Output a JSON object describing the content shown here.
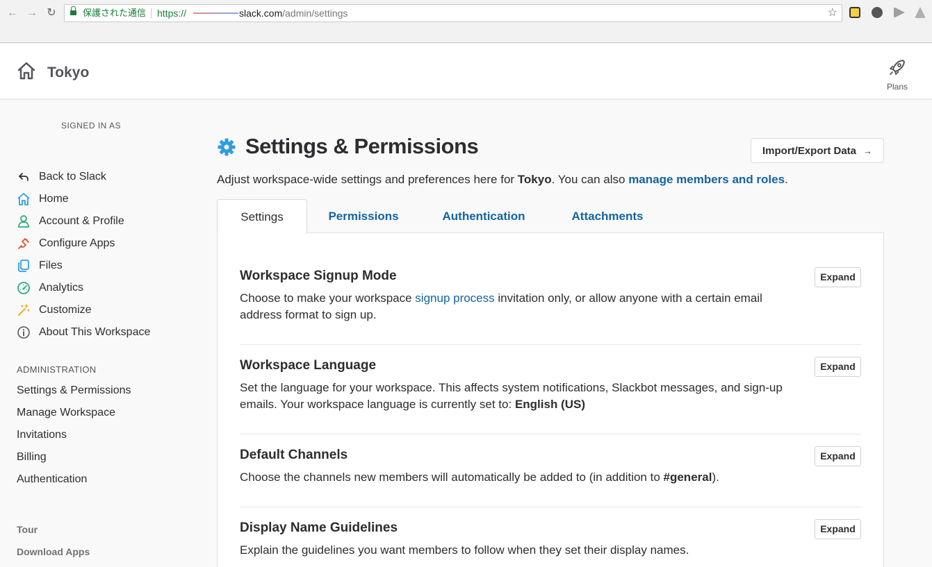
{
  "browser": {
    "secure_label": "保護された通信",
    "url_scheme": "https://",
    "url_host": "slack.com",
    "url_path": "/admin/settings"
  },
  "header": {
    "team_name": "Tokyo",
    "plans_label": "Plans"
  },
  "sidebar": {
    "signed_in_label": "SIGNED IN AS",
    "items": [
      {
        "label": "Back to Slack",
        "icon": "arrow-back-icon"
      },
      {
        "label": "Home",
        "icon": "home-icon"
      },
      {
        "label": "Account & Profile",
        "icon": "person-icon"
      },
      {
        "label": "Configure Apps",
        "icon": "plug-icon"
      },
      {
        "label": "Files",
        "icon": "files-icon"
      },
      {
        "label": "Analytics",
        "icon": "gauge-icon"
      },
      {
        "label": "Customize",
        "icon": "magic-wand-icon"
      },
      {
        "label": "About This Workspace",
        "icon": "info-icon"
      }
    ],
    "admin_heading": "ADMINISTRATION",
    "admin_items": [
      "Settings & Permissions",
      "Manage Workspace",
      "Invitations",
      "Billing",
      "Authentication"
    ],
    "footer_links": [
      "Tour",
      "Download Apps"
    ]
  },
  "main": {
    "title": "Settings & Permissions",
    "import_button": "Import/Export Data",
    "lead_prefix": "Adjust workspace-wide settings and preferences here for ",
    "lead_team": "Tokyo",
    "lead_middle": ". You can also ",
    "lead_link": "manage members and roles",
    "lead_suffix": ".",
    "tabs": [
      "Settings",
      "Permissions",
      "Authentication",
      "Attachments"
    ],
    "expand_label": "Expand",
    "sections": [
      {
        "title": "Workspace Signup Mode",
        "desc_prefix": "Choose to make your workspace ",
        "desc_link": "signup process",
        "desc_suffix": " invitation only, or allow anyone with a certain email address format to sign up."
      },
      {
        "title": "Workspace Language",
        "desc_prefix": "Set the language for your workspace. This affects system notifications, Slackbot messages, and sign-up emails. Your workspace language is currently set to: ",
        "desc_bold": "English (US)"
      },
      {
        "title": "Default Channels",
        "desc_prefix": "Choose the channels new members will automatically be added to (in addition to ",
        "desc_bold": "#general",
        "desc_suffix": ")."
      },
      {
        "title": "Display Name Guidelines",
        "desc_prefix": "Explain the guidelines you want members to follow when they set their display names."
      }
    ]
  },
  "colors": {
    "link": "#1264a3",
    "text": "#2c2d30",
    "cog": "#2d9ee0",
    "secure": "#188038"
  }
}
